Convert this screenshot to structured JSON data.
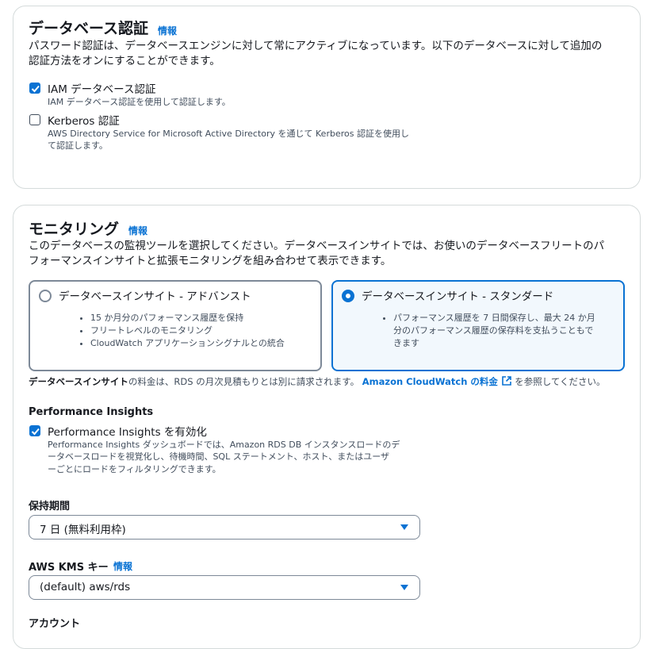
{
  "auth": {
    "title": "データベース認証",
    "info": "情報",
    "desc_line1": "パスワード認証は、データベースエンジンに対して常にアクティブになっています。以下のデータベースに対して追加の",
    "desc_line2": "認証方法をオンにすることができます。",
    "options": [
      {
        "label": "IAM データベース認証",
        "sub1": "IAM データベース認証を使用して認証します。",
        "sub2": "",
        "checked": true
      },
      {
        "label": "Kerberos 認証",
        "sub1": "AWS Directory Service for Microsoft Active Directory を通じて Kerberos 認証を使用し",
        "sub2": "て認証します。",
        "checked": false
      }
    ]
  },
  "monitoring": {
    "title": "モニタリング",
    "info": "情報",
    "desc_line1": "このデータベースの監視ツールを選択してください。データベースインサイトでは、お使いのデータベースフリートのパ",
    "desc_line2": "フォーマンスインサイトと拡張モニタリングを組み合わせて表示できます。",
    "tiles": [
      {
        "title": "データベースインサイト - アドバンスト",
        "selected": false,
        "bullets": [
          "15 か月分のパフォーマンス履歴を保持",
          "フリートレベルのモニタリング",
          "CloudWatch アプリケーションシグナルとの統合"
        ]
      },
      {
        "title": "データベースインサイト - スタンダード",
        "selected": true,
        "bullets": [
          "パフォーマンス履歴を 7 日間保存し、最大 24 か月",
          "分のパフォーマンス履歴の保存料を支払うこともで",
          "きます"
        ]
      }
    ],
    "note_bold": "データベースインサイト",
    "note_mid": "の料金は、RDS の月次見積もりとは別に請求されます。",
    "note_link": "Amazon CloudWatch の料金",
    "note_end": "を参照してください。",
    "pi_section": "Performance Insights",
    "pi_label": "Performance Insights を有効化",
    "pi_checked": true,
    "pi_sub1": "Performance Insights ダッシュボードでは、Amazon RDS DB インスタンスロードのデ",
    "pi_sub2": "ータベースロードを視覚化し、待機時間、SQL ステートメント、ホスト、またはユーザ",
    "pi_sub3": "ーごとにロードをフィルタリングできます。",
    "retention_label": "保持期間",
    "retention_value": "7 日 (無料利用枠)",
    "kms_label": "AWS KMS キー",
    "kms_info": "情報",
    "kms_value": "(default) aws/rds",
    "account_label": "アカウント"
  },
  "colors": {
    "accent": "#0972d3",
    "border": "#d5dbdb",
    "text": "#16191f",
    "subtext": "#414d5c",
    "selected_bg": "#f2f8fd"
  }
}
